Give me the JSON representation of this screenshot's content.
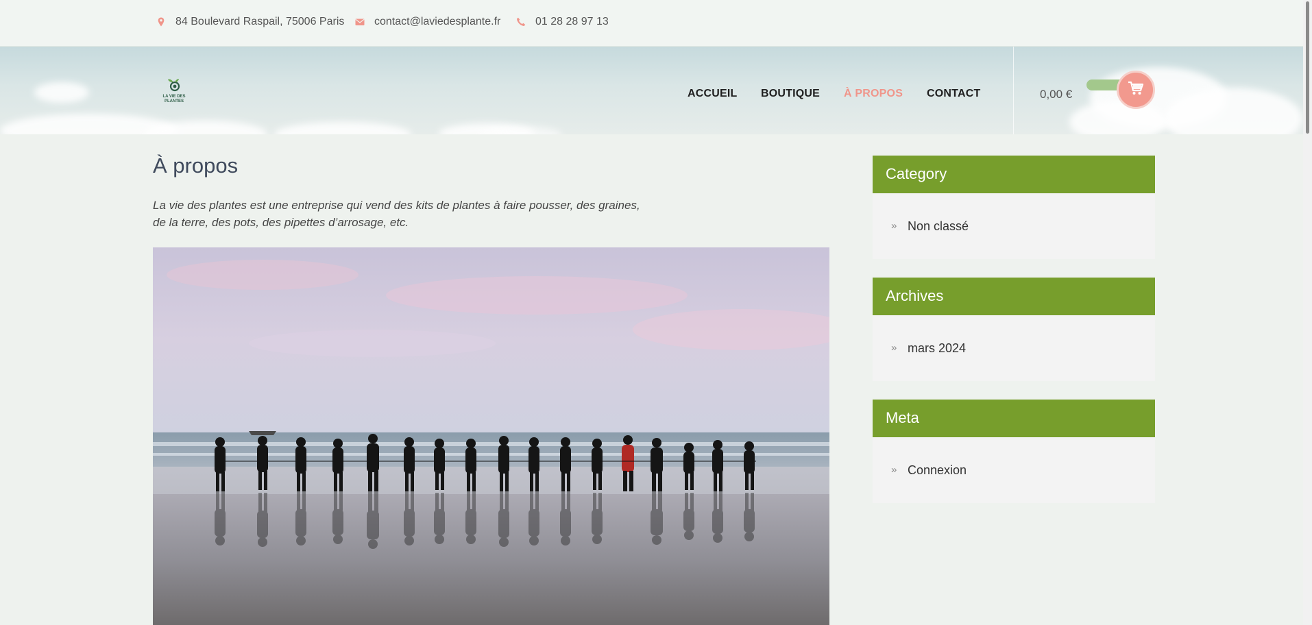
{
  "topbar": {
    "address": "84 Boulevard Raspail, 75006 Paris",
    "email": "contact@laviedesplante.fr",
    "phone": "01 28 28 97 13"
  },
  "header": {
    "logo_text_line1": "LA VIE DES",
    "logo_text_line2": "PLANTES",
    "nav": [
      {
        "label": "ACCUEIL",
        "active": false
      },
      {
        "label": "BOUTIQUE",
        "active": false
      },
      {
        "label": "À PROPOS",
        "active": true
      },
      {
        "label": "CONTACT",
        "active": false
      }
    ],
    "cart_total": "0,00 €"
  },
  "main": {
    "title": "À propos",
    "intro_line1": "La vie des plantes est une entreprise qui vend des kits de plantes à faire pousser, des graines,",
    "intro_line2": "de la terre, des pots, des pipettes d’arrosage, etc."
  },
  "sidebar": {
    "widgets": [
      {
        "title": "Category",
        "link": "Non classé"
      },
      {
        "title": "Archives",
        "link": "mars 2024"
      },
      {
        "title": "Meta",
        "link": "Connexion"
      }
    ]
  },
  "colors": {
    "accent": "#f0958a",
    "widget_header": "#779e2c",
    "cart_pill": "#a3c88c"
  },
  "icons": [
    "map-pin-icon",
    "envelope-icon",
    "phone-icon",
    "cart-icon",
    "chevron-double-right-icon"
  ]
}
